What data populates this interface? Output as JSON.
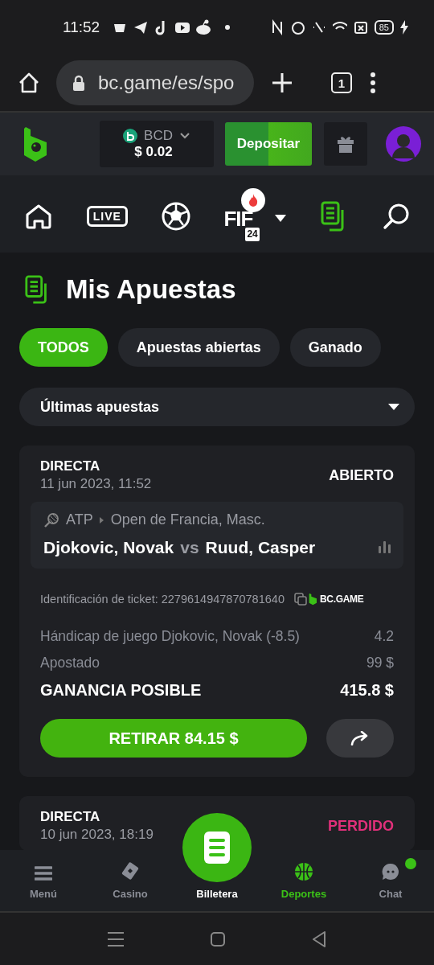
{
  "status_bar": {
    "time": "11:52",
    "battery": "85"
  },
  "browser": {
    "url": "bc.game/es/spo",
    "tab_count": "1"
  },
  "header": {
    "currency": "BCD",
    "balance": "$ 0.02",
    "deposit": "Depositar"
  },
  "nav": [
    {
      "kind": "home",
      "selected": false
    },
    {
      "kind": "live",
      "label": "LIVE",
      "selected": false
    },
    {
      "kind": "soccer",
      "selected": false
    },
    {
      "kind": "fifa",
      "label": "FIF",
      "sub": "24",
      "selected": false
    },
    {
      "kind": "bets",
      "selected": true
    },
    {
      "kind": "search",
      "selected": false
    }
  ],
  "page_title": "Mis Apuestas",
  "filters": [
    {
      "label": "TODOS",
      "selected": true
    },
    {
      "label": "Apuestas abiertas",
      "selected": false
    },
    {
      "label": "Ganado",
      "selected": false
    }
  ],
  "sort": "Últimas apuestas",
  "bets": [
    {
      "type": "DIRECTA",
      "date": "11 jun 2023, 11:52",
      "status": "ABIERTO",
      "color": "#ffffff",
      "league": "ATP",
      "tournament": "Open de Francia, Masc.",
      "home": "Djokovic, Novak",
      "vs": "vs",
      "away": "Ruud, Casper",
      "ticket": "Identificación de ticket: 2279614947870781640",
      "brand": "BC.GAME",
      "selection": "Hándicap de juego Djokovic, Novak (-8.5)",
      "odds": "4.2",
      "stake_label": "Apostado",
      "stake": "99 $",
      "payout_label": "GANANCIA POSIBLE",
      "payout": "415.8 $",
      "cashout": "RETIRAR 84.15 $"
    },
    {
      "type": "DIRECTA",
      "date": "10 jun 2023, 18:19",
      "status": "PERDIDO",
      "color": "#e0307a"
    }
  ],
  "bottom_nav": [
    {
      "kind": "menu",
      "label": "Menú",
      "selected": false,
      "notification": false
    },
    {
      "kind": "casino",
      "label": "Casino",
      "selected": false,
      "notification": false
    },
    {
      "kind": "wallet",
      "label": "Billetera",
      "selected": false,
      "notification": false
    },
    {
      "kind": "sports",
      "label": "Deportes",
      "selected": true,
      "notification": false
    },
    {
      "kind": "chat",
      "label": "Chat",
      "selected": false,
      "notification": true
    }
  ]
}
